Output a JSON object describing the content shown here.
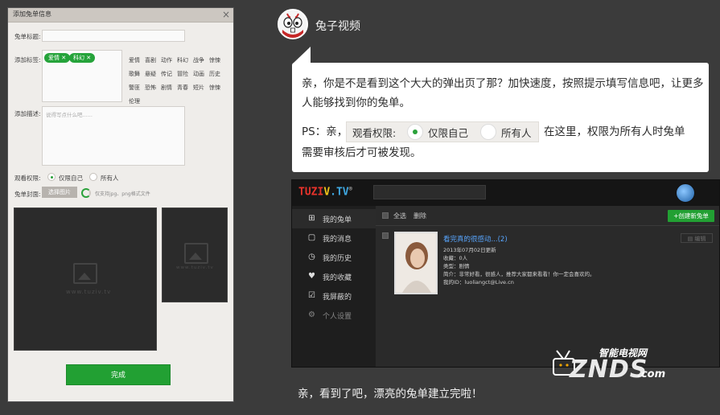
{
  "dialog": {
    "title": "添加兔单信息",
    "close": "×",
    "labels": {
      "name": "兔单标题:",
      "tags": "添加标签:",
      "desc": "添加描述:",
      "permission": "观看权限:",
      "cover": "兔单封面:"
    },
    "name_value": "",
    "selected_tags": [
      "爱情",
      "科幻"
    ],
    "tag_options": [
      "爱情",
      "喜剧",
      "动作",
      "科幻",
      "战争",
      "惊悚",
      "歌舞",
      "悬疑",
      "传记",
      "冒险",
      "动画",
      "历史",
      "警匪",
      "恐怖",
      "剧情",
      "青春",
      "短片",
      "惊悚",
      "伦理"
    ],
    "desc_placeholder": "说得写点什么吧......",
    "perm_options": [
      "仅限自己",
      "所有人"
    ],
    "perm_selected": 0,
    "choose_image": "选择图片",
    "image_hint": "仅支持jpg、png格式文件",
    "watermark": "www.tuziv.tv",
    "done": "完成"
  },
  "chat": {
    "username": "兔子视频",
    "message_line1": "亲，你是不是看到这个大大的弹出页了那？加快速度，按照提示填写信息吧，让更多人能够找到你的兔单。",
    "ps_prefix": "PS：亲，",
    "ps_label": "观看权限:",
    "ps_options": [
      "仅限自己",
      "所有人"
    ],
    "ps_selected": 0,
    "ps_after": "在这里，权限为所有人时兔单",
    "message_line3": "需要审核后才可被发现。"
  },
  "app": {
    "logo": "TUZIV.TV",
    "logo_mark": "®",
    "search_value": "",
    "sidebar": [
      {
        "label": "我的兔单",
        "icon": "plus-square-icon"
      },
      {
        "label": "我的消息",
        "icon": "message-square-icon"
      },
      {
        "label": "我的历史",
        "icon": "clock-icon"
      },
      {
        "label": "我的收藏",
        "icon": "heart-icon"
      },
      {
        "label": "我屏蔽的",
        "icon": "checkbox-icon"
      },
      {
        "label": "个人设置",
        "icon": "gear-icon"
      }
    ],
    "toolbar": {
      "select_all": "全选",
      "delete": "删除",
      "new": "+创建新兔单"
    },
    "item": {
      "title": "看完真的很感动...(2)",
      "updated": "2013年07月02日更新",
      "collect": "收藏：0人",
      "type": "类型：剧情",
      "intro": "简介：非常好看，很感人，推荐大家都来看看！你一定会喜欢的。",
      "myid": "我的ID：luoliangct@Live.cn",
      "edit": "编辑"
    }
  },
  "footer_text": "亲，看到了吧，漂亮的兔单建立完啦！",
  "watermark": {
    "top": "智能电视网",
    "main": "ZNDS",
    "suffix": ".com"
  },
  "colors": {
    "accent": "#22a033",
    "link": "#58a6ff",
    "bg": "#3b3b3b"
  }
}
